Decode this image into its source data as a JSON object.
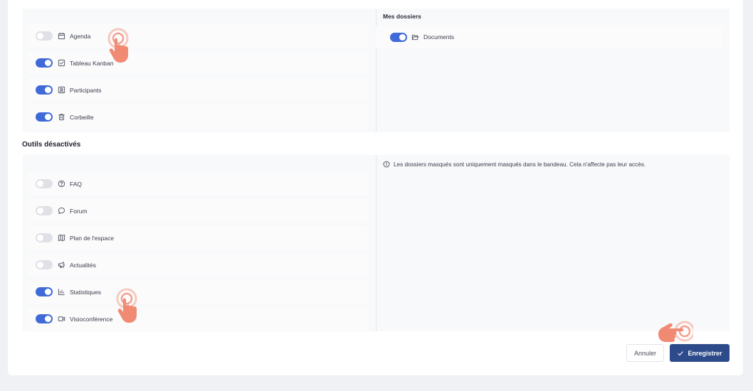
{
  "active_section": {
    "tools": [
      {
        "label": "Agenda",
        "icon": "calendar-icon",
        "enabled": false
      },
      {
        "label": "Tableau Kanban",
        "icon": "checkbox-icon",
        "enabled": true
      },
      {
        "label": "Participants",
        "icon": "contact-icon",
        "enabled": true
      },
      {
        "label": "Corbeille",
        "icon": "trash-icon",
        "enabled": true
      }
    ],
    "folders_title": "Mes dossiers",
    "folders": [
      {
        "label": "Documents",
        "icon": "folder-open-icon",
        "enabled": true
      }
    ]
  },
  "disabled_section": {
    "title": "Outils désactivés",
    "info": "Les dossiers masqués sont uniquement masqués dans le bandeau. Cela n'affecte pas leur accès.",
    "tools": [
      {
        "label": "FAQ",
        "icon": "help-circle-icon",
        "enabled": false
      },
      {
        "label": "Forum",
        "icon": "chat-bubble-icon",
        "enabled": false
      },
      {
        "label": "Plan de l'espace",
        "icon": "map-icon",
        "enabled": false
      },
      {
        "label": "Actualités",
        "icon": "megaphone-icon",
        "enabled": false
      },
      {
        "label": "Statistiques",
        "icon": "bar-chart-icon",
        "enabled": true
      },
      {
        "label": "Visioconférence",
        "icon": "video-icon",
        "enabled": true
      }
    ]
  },
  "actions": {
    "cancel_label": "Annuler",
    "save_label": "Enregistrer"
  },
  "colors": {
    "toggle_on": "#3f6ad8",
    "toggle_off": "#e0e1e6",
    "primary_button": "#2d4a8a",
    "hand_pointer": "#f08a72"
  }
}
